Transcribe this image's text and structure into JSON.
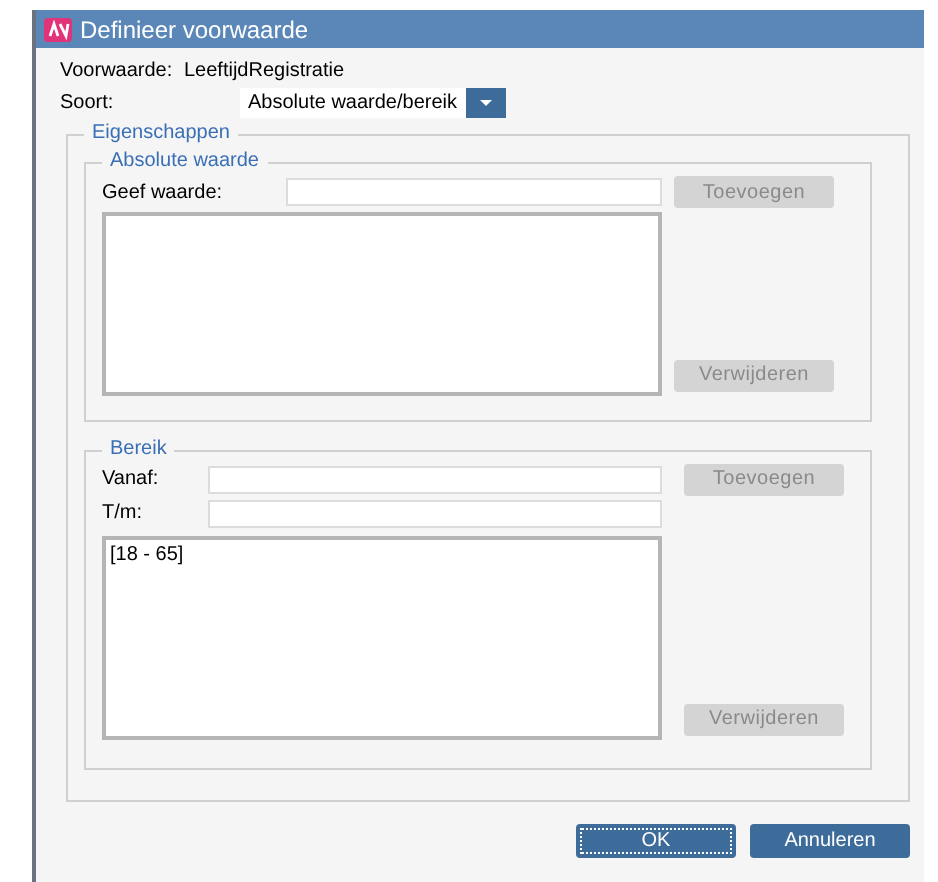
{
  "window": {
    "title": "Definieer voorwaarde"
  },
  "condition": {
    "label": "Voorwaarde:",
    "value": "LeeftijdRegistratie"
  },
  "type": {
    "label": "Soort:",
    "value": "Absolute waarde/bereik"
  },
  "properties": {
    "title": "Eigenschappen",
    "absolute": {
      "title": "Absolute waarde",
      "field_label": "Geef waarde:",
      "add_button": {
        "label": "Toevoegen",
        "disabled": true
      },
      "remove_button": {
        "label": "Verwijderen",
        "disabled": true
      }
    },
    "range": {
      "title": "Bereik",
      "from_label": "Vanaf:",
      "to_label": "T/m:",
      "add_button": {
        "label": "Toevoegen",
        "disabled": true
      },
      "items": [
        "[18 - 65]"
      ],
      "remove_button": {
        "label": "Verwijderen",
        "disabled": true
      }
    }
  },
  "buttons": [
    {
      "label": "OK",
      "focused": true
    },
    {
      "label": "Annuleren",
      "focused": false
    }
  ]
}
